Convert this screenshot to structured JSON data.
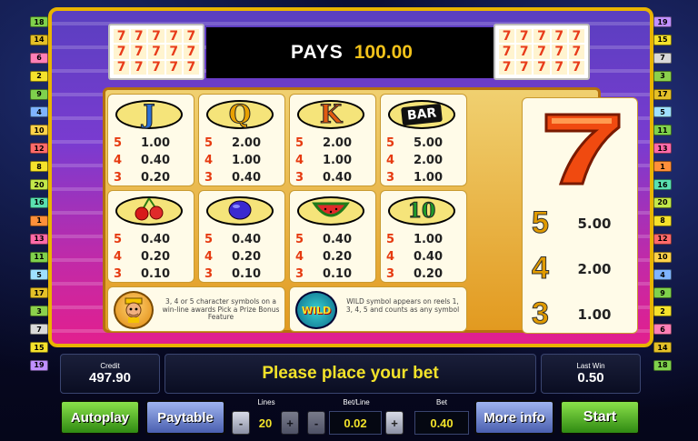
{
  "lines_left": [
    {
      "n": "18",
      "color": "#7fd14c"
    },
    {
      "n": "14",
      "color": "#e4c028"
    },
    {
      "n": "6",
      "color": "#ff7fb6"
    },
    {
      "n": "2",
      "color": "#f5e22c"
    },
    {
      "n": "9",
      "color": "#7fd14c"
    },
    {
      "n": "4",
      "color": "#7fb4ff"
    },
    {
      "n": "10",
      "color": "#ffd24a"
    },
    {
      "n": "12",
      "color": "#ff6a6a"
    },
    {
      "n": "8",
      "color": "#f5e22c"
    },
    {
      "n": "20",
      "color": "#c3e84a"
    },
    {
      "n": "16",
      "color": "#5ae0b0"
    },
    {
      "n": "1",
      "color": "#ff8f3a"
    },
    {
      "n": "13",
      "color": "#ff6aa8"
    },
    {
      "n": "11",
      "color": "#7fd14c"
    },
    {
      "n": "5",
      "color": "#9fe0ff"
    },
    {
      "n": "17",
      "color": "#e4c028"
    },
    {
      "n": "3",
      "color": "#8bd14c"
    },
    {
      "n": "7",
      "color": "#d9d9d9"
    },
    {
      "n": "15",
      "color": "#f5e22c"
    },
    {
      "n": "19",
      "color": "#c090ff"
    }
  ],
  "lines_right": [
    {
      "n": "19",
      "color": "#c090ff"
    },
    {
      "n": "15",
      "color": "#f5e22c"
    },
    {
      "n": "7",
      "color": "#d9d9d9"
    },
    {
      "n": "3",
      "color": "#8bd14c"
    },
    {
      "n": "17",
      "color": "#e4c028"
    },
    {
      "n": "5",
      "color": "#9fe0ff"
    },
    {
      "n": "11",
      "color": "#7fd14c"
    },
    {
      "n": "13",
      "color": "#ff6aa8"
    },
    {
      "n": "1",
      "color": "#ff8f3a"
    },
    {
      "n": "16",
      "color": "#5ae0b0"
    },
    {
      "n": "20",
      "color": "#c3e84a"
    },
    {
      "n": "8",
      "color": "#f5e22c"
    },
    {
      "n": "12",
      "color": "#ff6a6a"
    },
    {
      "n": "10",
      "color": "#ffd24a"
    },
    {
      "n": "4",
      "color": "#7fb4ff"
    },
    {
      "n": "9",
      "color": "#7fd14c"
    },
    {
      "n": "2",
      "color": "#f5e22c"
    },
    {
      "n": "6",
      "color": "#ff7fb6"
    },
    {
      "n": "14",
      "color": "#e4c028"
    },
    {
      "n": "18",
      "color": "#7fd14c"
    }
  ],
  "header": {
    "pays_label": "PAYS",
    "pays_value": "100.00",
    "mini_symbol": "7"
  },
  "paytable": {
    "symbols": [
      {
        "name": "J",
        "glyph": "J",
        "color": "#2a6fd6",
        "pays": [
          {
            "n": "5",
            "v": "1.00"
          },
          {
            "n": "4",
            "v": "0.40"
          },
          {
            "n": "3",
            "v": "0.20"
          }
        ]
      },
      {
        "name": "Q",
        "glyph": "Q",
        "color": "#e8a000",
        "pays": [
          {
            "n": "5",
            "v": "2.00"
          },
          {
            "n": "4",
            "v": "1.00"
          },
          {
            "n": "3",
            "v": "0.40"
          }
        ]
      },
      {
        "name": "K",
        "glyph": "K",
        "color": "#e05a10",
        "pays": [
          {
            "n": "5",
            "v": "2.00"
          },
          {
            "n": "4",
            "v": "1.00"
          },
          {
            "n": "3",
            "v": "0.40"
          }
        ]
      },
      {
        "name": "BAR",
        "glyph": "BAR",
        "color": "#ffffff",
        "pays": [
          {
            "n": "5",
            "v": "5.00"
          },
          {
            "n": "4",
            "v": "2.00"
          },
          {
            "n": "3",
            "v": "1.00"
          }
        ]
      },
      {
        "name": "cherries",
        "glyph": "",
        "color": "#d81a1a",
        "pays": [
          {
            "n": "5",
            "v": "0.40"
          },
          {
            "n": "4",
            "v": "0.20"
          },
          {
            "n": "3",
            "v": "0.10"
          }
        ]
      },
      {
        "name": "plum",
        "glyph": "",
        "color": "#3a2ad0",
        "pays": [
          {
            "n": "5",
            "v": "0.40"
          },
          {
            "n": "4",
            "v": "0.20"
          },
          {
            "n": "3",
            "v": "0.10"
          }
        ]
      },
      {
        "name": "watermelon",
        "glyph": "",
        "color": "#1f9a2a",
        "pays": [
          {
            "n": "5",
            "v": "0.40"
          },
          {
            "n": "4",
            "v": "0.20"
          },
          {
            "n": "3",
            "v": "0.10"
          }
        ]
      },
      {
        "name": "ten",
        "glyph": "10",
        "color": "#1f9a2a",
        "pays": [
          {
            "n": "5",
            "v": "1.00"
          },
          {
            "n": "4",
            "v": "0.40"
          },
          {
            "n": "3",
            "v": "0.20"
          }
        ]
      }
    ],
    "seven": {
      "glyph": "7",
      "pays": [
        {
          "n": "5",
          "v": "5.00"
        },
        {
          "n": "4",
          "v": "2.00"
        },
        {
          "n": "3",
          "v": "1.00"
        }
      ]
    },
    "character_note": "3, 4 or 5 character symbols on a win-line awards Pick a Prize Bonus Feature",
    "wild_label": "WILD",
    "wild_note": "WILD symbol appears on reels 1, 3, 4, 5 and counts as any symbol"
  },
  "status": {
    "credit_label": "Credit",
    "credit_value": "497.90",
    "message": "Please place your bet",
    "last_win_label": "Last Win",
    "last_win_value": "0.50"
  },
  "controls": {
    "autoplay": "Autoplay",
    "paytable": "Paytable",
    "lines_label": "Lines",
    "lines_value": "20",
    "betline_label": "Bet/Line",
    "betline_value": "0.02",
    "bet_label": "Bet",
    "bet_value": "0.40",
    "minus": "-",
    "plus": "+",
    "more_info": "More info",
    "start": "Start"
  }
}
